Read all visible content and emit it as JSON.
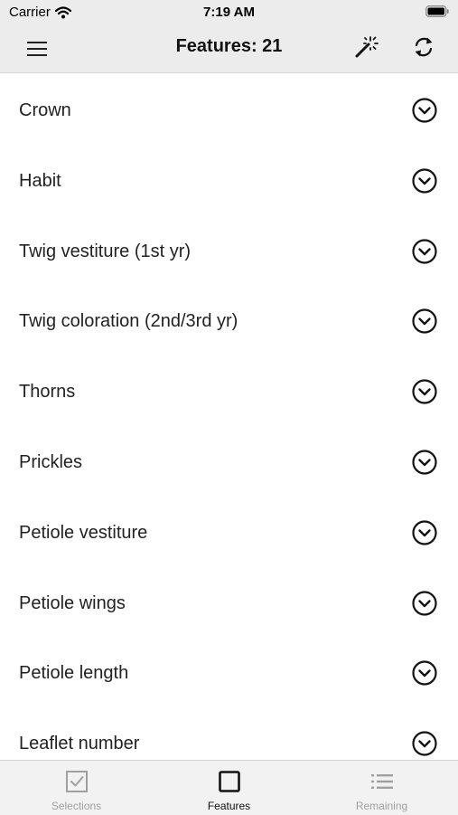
{
  "status_bar": {
    "carrier": "Carrier",
    "time": "7:19 AM"
  },
  "nav": {
    "title": "Features: 21",
    "menu_icon": "hamburger-menu-icon",
    "wand_icon": "magic-wand-icon",
    "refresh_icon": "refresh-icon"
  },
  "features": [
    {
      "label": "Crown"
    },
    {
      "label": "Habit"
    },
    {
      "label": "Twig vestiture (1st yr)"
    },
    {
      "label": "Twig coloration (2nd/3rd yr)"
    },
    {
      "label": "Thorns"
    },
    {
      "label": "Prickles"
    },
    {
      "label": "Petiole vestiture"
    },
    {
      "label": "Petiole wings"
    },
    {
      "label": "Petiole length"
    },
    {
      "label": "Leaflet number"
    }
  ],
  "tabs": [
    {
      "label": "Selections",
      "icon": "checkbox-icon",
      "active": false
    },
    {
      "label": "Features",
      "icon": "square-icon",
      "active": true
    },
    {
      "label": "Remaining",
      "icon": "list-icon",
      "active": false
    }
  ],
  "colors": {
    "bar_background": "#ececec",
    "text": "#1c1c1e",
    "inactive_tab": "#a0a0a0"
  }
}
